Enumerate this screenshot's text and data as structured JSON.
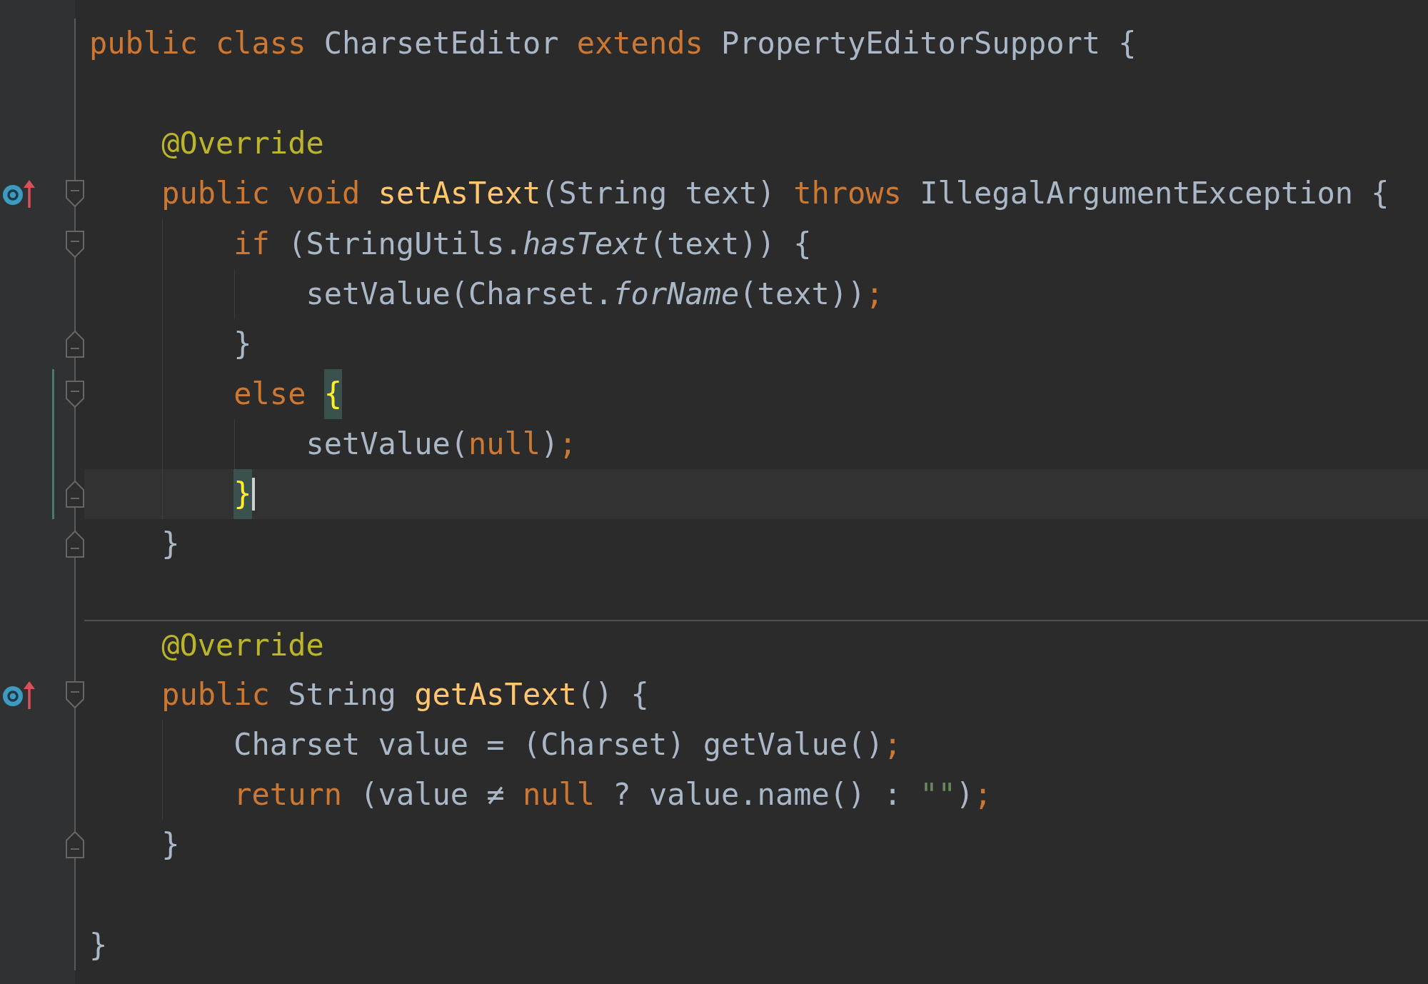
{
  "editor": {
    "lines": [
      {
        "tokens": [
          {
            "text": "public class ",
            "kind": "keyword"
          },
          {
            "text": "CharsetEditor ",
            "kind": "plain"
          },
          {
            "text": "extends ",
            "kind": "keyword"
          },
          {
            "text": "PropertyEditorSupport {",
            "kind": "plain"
          }
        ],
        "blank_line_after": true
      },
      {
        "tokens": [
          {
            "text": "    @Override",
            "kind": "annotation"
          }
        ]
      },
      {
        "tokens": [
          {
            "text": "    public void ",
            "kind": "keyword"
          },
          {
            "text": "setAsText",
            "kind": "method"
          },
          {
            "text": "(String text) ",
            "kind": "plain"
          },
          {
            "text": "throws ",
            "kind": "keyword"
          },
          {
            "text": "IllegalArgumentException {",
            "kind": "plain"
          }
        ],
        "override_marker": true,
        "fold_start": true
      },
      {
        "tokens": [
          {
            "text": "        if ",
            "kind": "keyword"
          },
          {
            "text": "(StringUtils.",
            "kind": "plain"
          },
          {
            "text": "hasText",
            "kind": "static"
          },
          {
            "text": "(text)) {",
            "kind": "plain"
          }
        ],
        "fold_start": true
      },
      {
        "tokens": [
          {
            "text": "            setValue(Charset.",
            "kind": "plain"
          },
          {
            "text": "forName",
            "kind": "static"
          },
          {
            "text": "(text))",
            "kind": "plain"
          },
          {
            "text": ";",
            "kind": "keyword"
          }
        ]
      },
      {
        "tokens": [
          {
            "text": "        }",
            "kind": "plain"
          }
        ],
        "fold_end": true
      },
      {
        "tokens": [
          {
            "text": "        else ",
            "kind": "keyword"
          },
          {
            "text": "{",
            "kind": "brace_match"
          }
        ],
        "fold_start": true,
        "changed": true
      },
      {
        "tokens": [
          {
            "text": "            setValue(",
            "kind": "plain"
          },
          {
            "text": "null",
            "kind": "keyword"
          },
          {
            "text": ")",
            "kind": "plain"
          },
          {
            "text": ";",
            "kind": "keyword"
          }
        ],
        "changed": true
      },
      {
        "tokens": [
          {
            "text": "        }",
            "kind": "brace_match"
          }
        ],
        "fold_end": true,
        "changed": true,
        "current": true,
        "caret": true
      },
      {
        "tokens": [
          {
            "text": "    }",
            "kind": "plain"
          }
        ],
        "fold_end": true,
        "blank_line_after": true
      },
      {
        "tokens": [
          {
            "text": "    @Override",
            "kind": "annotation"
          }
        ],
        "separator_above": true
      },
      {
        "tokens": [
          {
            "text": "    public ",
            "kind": "keyword"
          },
          {
            "text": "String ",
            "kind": "plain"
          },
          {
            "text": "getAsText",
            "kind": "method"
          },
          {
            "text": "() {",
            "kind": "plain"
          }
        ],
        "override_marker": true,
        "fold_start": true
      },
      {
        "tokens": [
          {
            "text": "        Charset value = (Charset) getValue()",
            "kind": "plain"
          },
          {
            "text": ";",
            "kind": "keyword"
          }
        ]
      },
      {
        "tokens": [
          {
            "text": "        return ",
            "kind": "keyword"
          },
          {
            "text": "(value ≠ ",
            "kind": "plain"
          },
          {
            "text": "null ",
            "kind": "keyword"
          },
          {
            "text": "? value.name() : ",
            "kind": "plain"
          },
          {
            "text": "\"\"",
            "kind": "string"
          },
          {
            "text": ")",
            "kind": "plain"
          },
          {
            "text": ";",
            "kind": "keyword"
          }
        ]
      },
      {
        "tokens": [
          {
            "text": "    }",
            "kind": "plain"
          }
        ],
        "fold_end": true,
        "blank_line_after": true
      },
      {
        "tokens": [
          {
            "text": "}",
            "kind": "plain"
          }
        ]
      }
    ]
  }
}
